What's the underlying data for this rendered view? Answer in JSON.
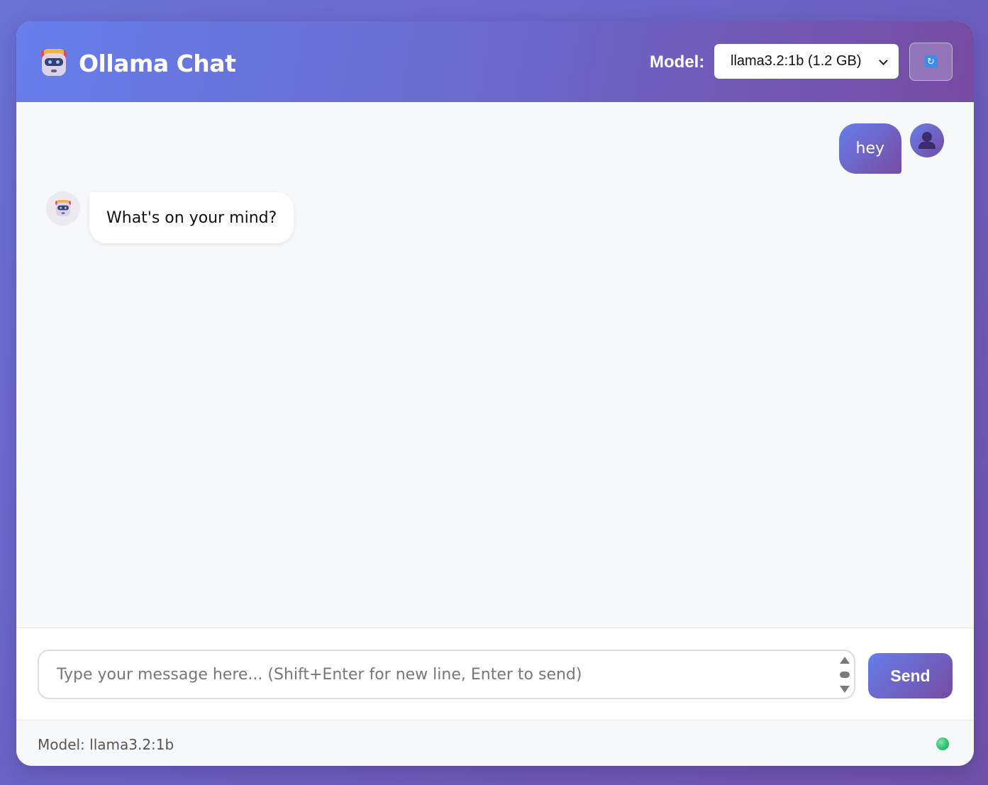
{
  "header": {
    "title": "Ollama Chat",
    "logo_icon": "robot-icon",
    "model_label": "Model:",
    "model_select": {
      "selected": "llama3.2:1b (1.2 GB)"
    },
    "refresh_icon": "refresh-icon"
  },
  "messages": [
    {
      "role": "user",
      "text": "hey",
      "avatar_icon": "user-icon"
    },
    {
      "role": "assistant",
      "text": "What's on your mind?",
      "avatar_icon": "robot-icon"
    }
  ],
  "input": {
    "placeholder": "Type your message here... (Shift+Enter for new line, Enter to send)",
    "value": "",
    "send_label": "Send"
  },
  "status": {
    "text": "Model: llama3.2:1b",
    "indicator_color": "#2fbf71"
  },
  "colors": {
    "accent_start": "#667eea",
    "accent_end": "#764ba2"
  }
}
